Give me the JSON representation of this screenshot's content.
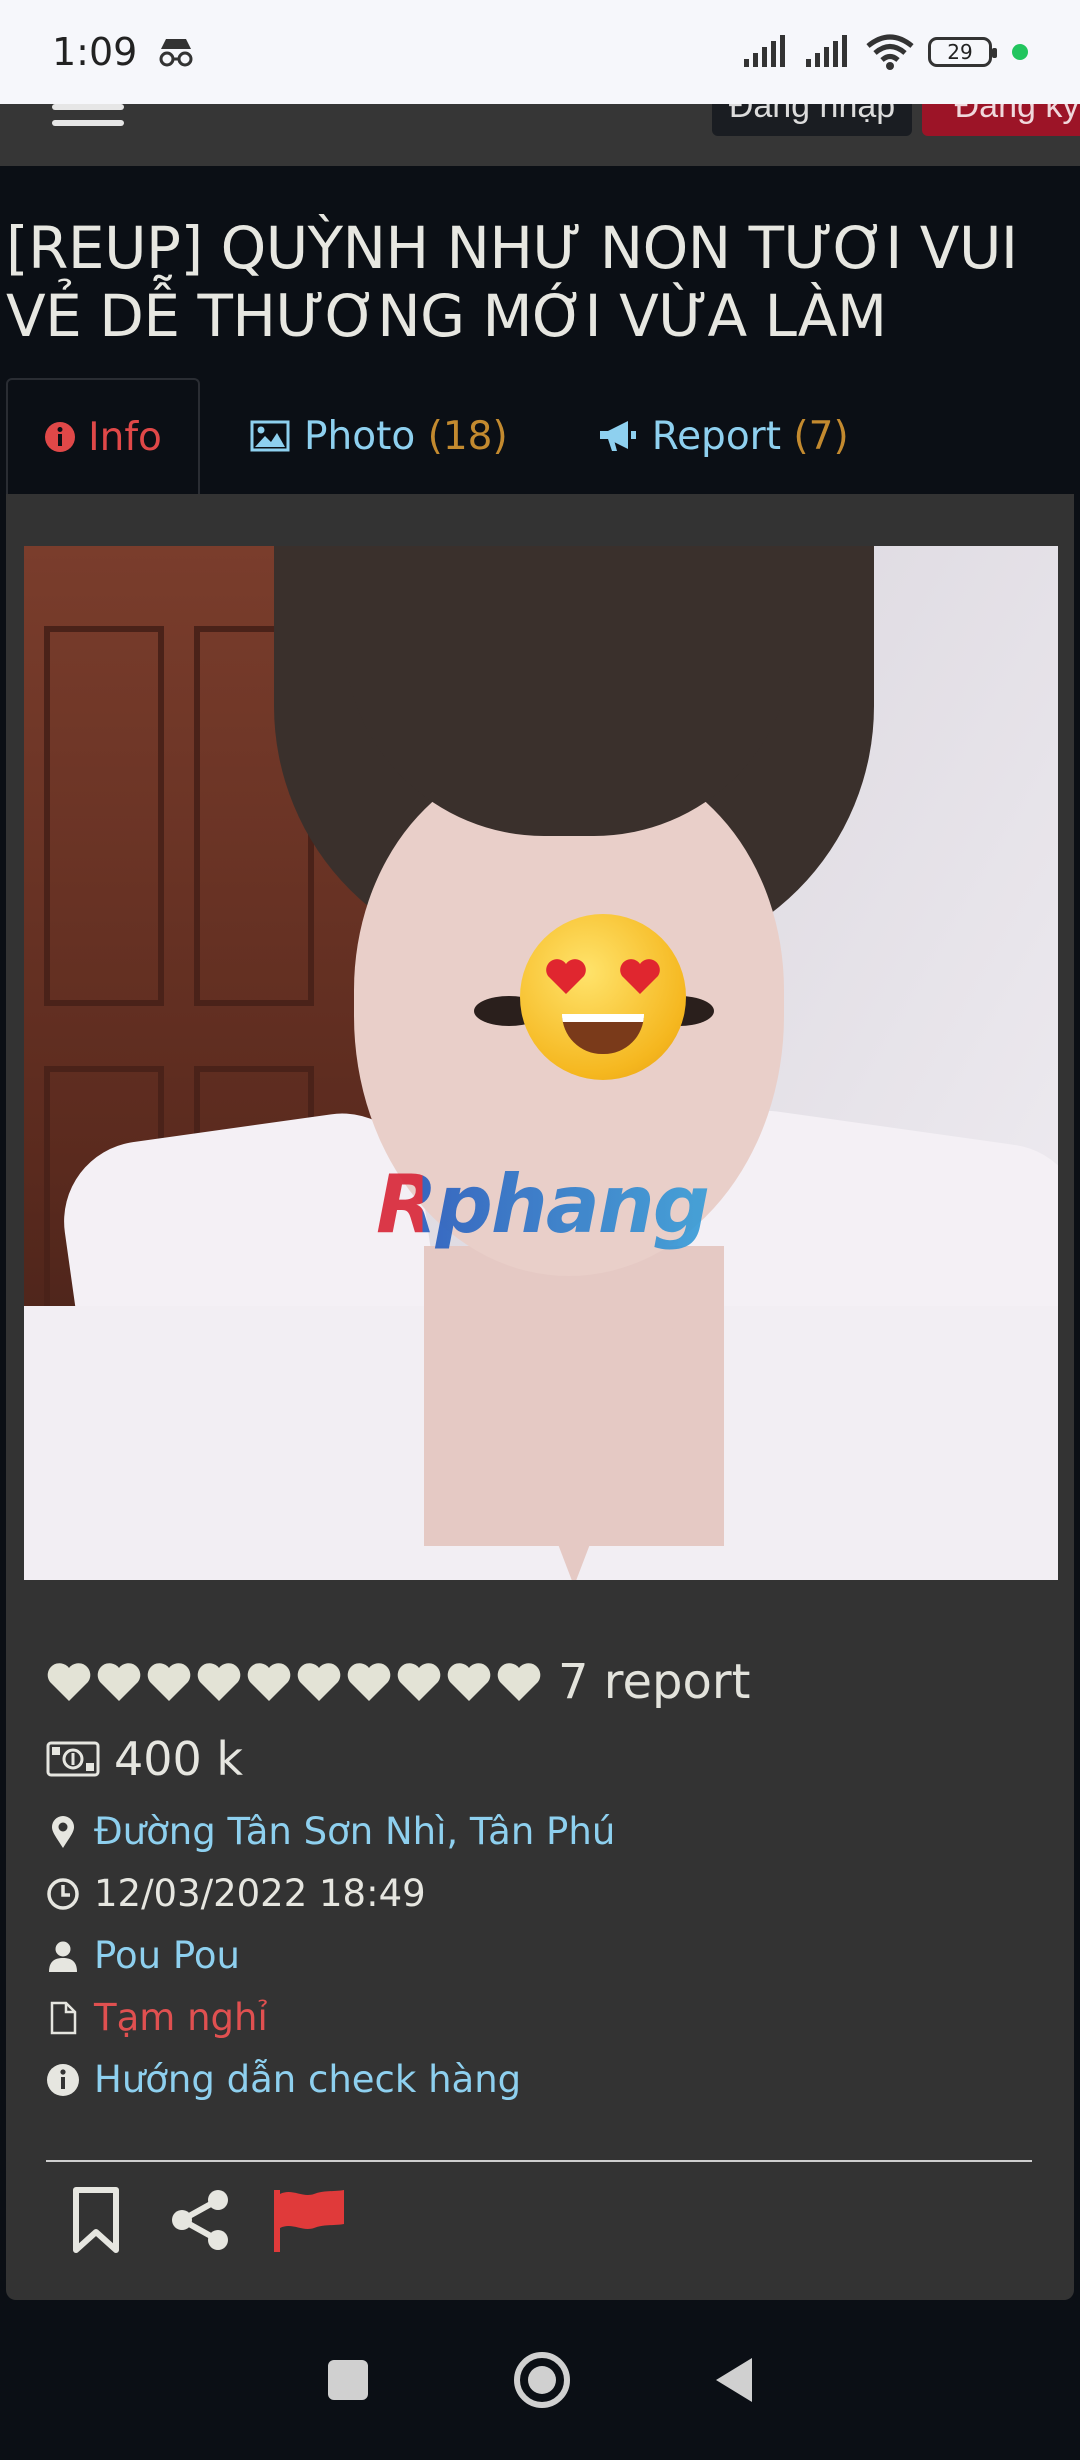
{
  "status_bar": {
    "time": "1:09",
    "battery": "29"
  },
  "topnav": {
    "login_label": "Đăng nhập",
    "register_label": "Đăng ký"
  },
  "page": {
    "title": "[REUP] QUỲNH NHƯ NON TƯƠI VUI VẺ DỄ THƯƠNG MỚI VỪA LÀM"
  },
  "tabs": [
    {
      "label": "Info",
      "count": "",
      "icon": "info-circle-icon"
    },
    {
      "label": "Photo",
      "count": "(18)",
      "icon": "image-icon"
    },
    {
      "label": "Report",
      "count": "(7)",
      "icon": "megaphone-icon"
    }
  ],
  "photo": {
    "watermark": "Rphang"
  },
  "details": {
    "hearts": 10,
    "report_text": "7 report",
    "price": "400 k",
    "location": "Đường Tân Sơn Nhì, Tân Phú",
    "datetime": "12/03/2022 18:49",
    "user": "Pou Pou",
    "status": "Tạm nghỉ",
    "guide": "Hướng dẫn check hàng"
  },
  "colors": {
    "accent_red": "#e04848",
    "link_blue": "#8ed0ef",
    "count_orange": "#c38a2f",
    "card_bg": "#333333",
    "page_bg": "#0b0f15"
  }
}
